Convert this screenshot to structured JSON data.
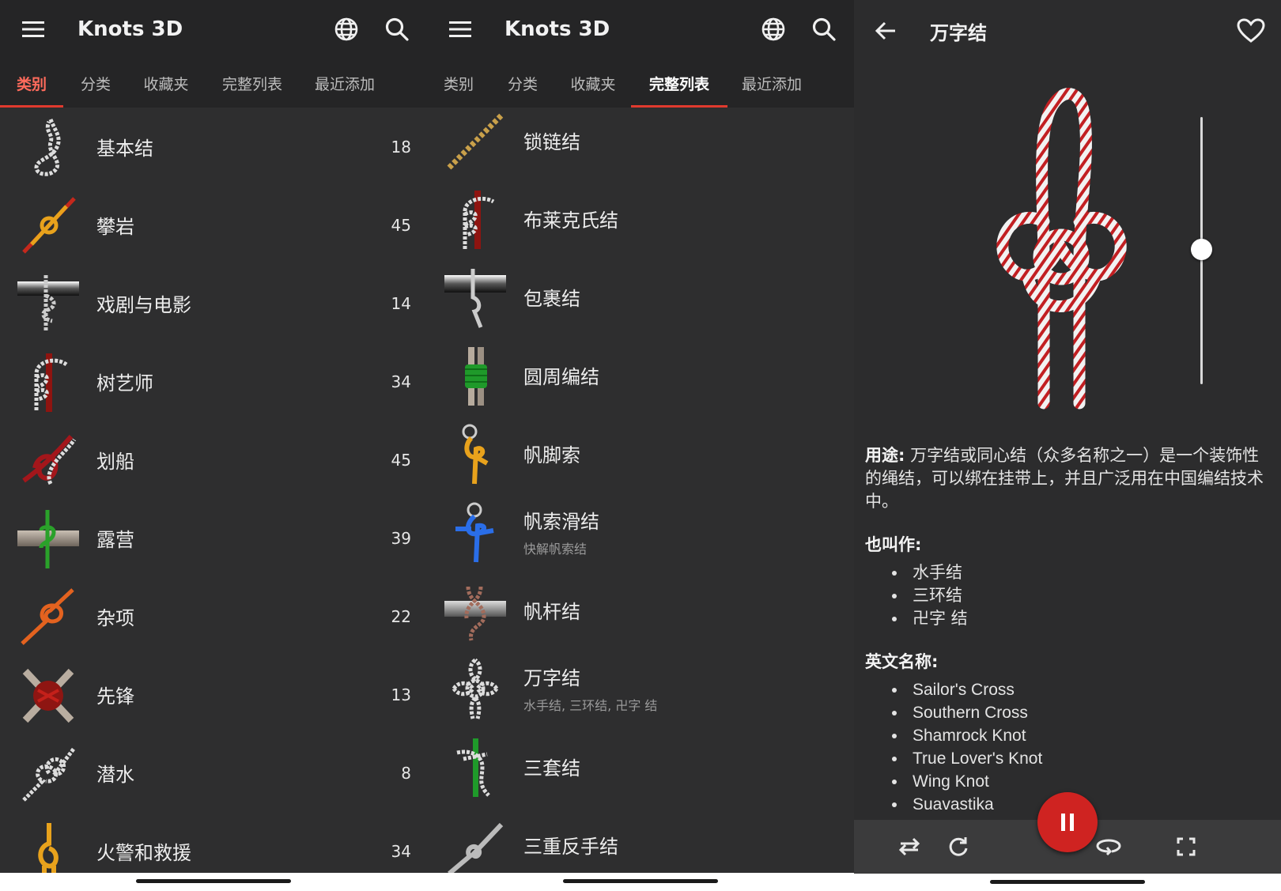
{
  "app": {
    "title": "Knots 3D"
  },
  "tabs": [
    "类别",
    "分类",
    "收藏夹",
    "完整列表",
    "最近添加"
  ],
  "categories": [
    {
      "label": "基本结",
      "count": "18"
    },
    {
      "label": "攀岩",
      "count": "45"
    },
    {
      "label": "戏剧与电影",
      "count": "14"
    },
    {
      "label": "树艺师",
      "count": "34"
    },
    {
      "label": "划船",
      "count": "45"
    },
    {
      "label": "露营",
      "count": "39"
    },
    {
      "label": "杂项",
      "count": "22"
    },
    {
      "label": "先锋",
      "count": "13"
    },
    {
      "label": "潜水",
      "count": "8"
    },
    {
      "label": "火警和救援",
      "count": "34"
    }
  ],
  "knots": [
    {
      "label": "锁链结",
      "sub": ""
    },
    {
      "label": "布莱克氏结",
      "sub": ""
    },
    {
      "label": "包裹结",
      "sub": ""
    },
    {
      "label": "圆周编结",
      "sub": ""
    },
    {
      "label": "帆脚索",
      "sub": ""
    },
    {
      "label": "帆索滑结",
      "sub": "快解帆索结"
    },
    {
      "label": "帆杆结",
      "sub": ""
    },
    {
      "label": "万字结",
      "sub": "水手结, 三环结, 卍字 结"
    },
    {
      "label": "三套结",
      "sub": ""
    },
    {
      "label": "三重反手结",
      "sub": ""
    }
  ],
  "detail": {
    "title": "万字结",
    "usage_label": "用途:",
    "usage_text": "万字结或同心结（众多名称之一）是一个装饰性的绳结，可以绑在挂带上，并且广泛用在中国编结技术中。",
    "aka_label": "也叫作:",
    "aka": [
      "水手结",
      "三环结",
      "卍字 结"
    ],
    "english_label": "英文名称:",
    "english": [
      "Sailor's Cross",
      "Southern Cross",
      "Shamrock Knot",
      "True Lover's Knot",
      "Wing Knot",
      "Suavastika"
    ]
  },
  "icons": {
    "menu": "menu-icon",
    "language": "globe-icon",
    "search": "search-icon",
    "back": "back-arrow-icon",
    "favorite": "heart-icon",
    "pause": "pause-icon",
    "swap": "swap-icon",
    "rotate": "rotate-icon",
    "loop": "loop-icon",
    "fullscreen": "fullscreen-icon"
  },
  "colors": {
    "accent": "#e03a2e",
    "fab": "#cf2321",
    "background": "#2e2e2f",
    "appbar": "#252526"
  }
}
